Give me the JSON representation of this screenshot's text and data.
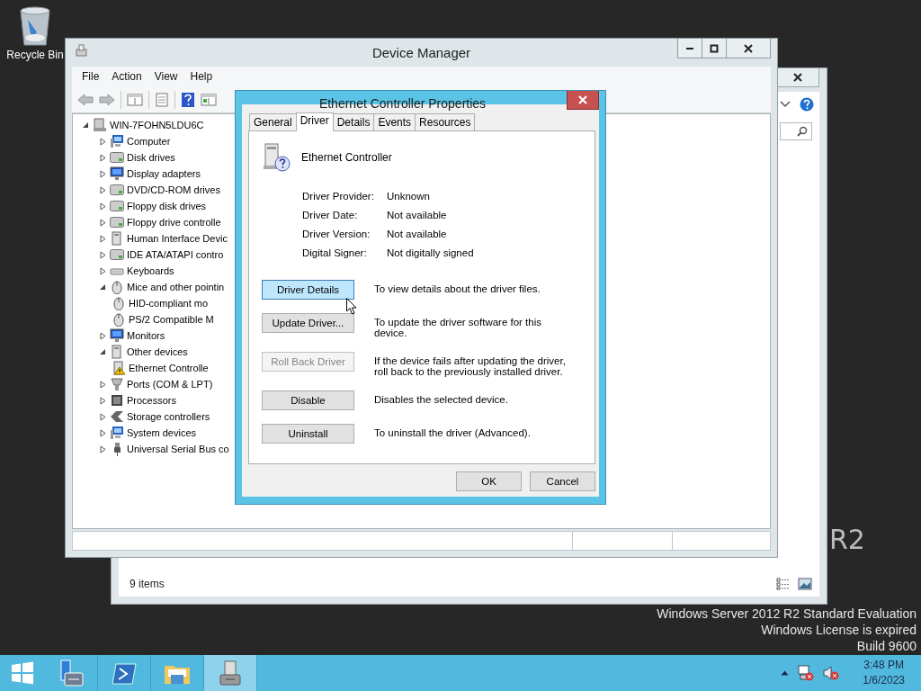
{
  "desktop": {
    "icons": [
      {
        "label": "Recycle Bin"
      }
    ],
    "brand": "R2",
    "notice": [
      "Windows Server 2012 R2 Standard Evaluation",
      "Windows License is expired",
      "Build 9600"
    ]
  },
  "back_window": {
    "status_bar": "9 items"
  },
  "device_manager": {
    "title": "Device Manager",
    "menu": [
      "File",
      "Action",
      "View",
      "Help"
    ],
    "tree": {
      "label": "WIN-7FOHN5LDU6C",
      "expanded": true,
      "children": [
        {
          "label": "Computer",
          "expanded": false
        },
        {
          "label": "Disk drives",
          "expanded": false
        },
        {
          "label": "Display adapters",
          "expanded": false
        },
        {
          "label": "DVD/CD-ROM drives",
          "expanded": false
        },
        {
          "label": "Floppy disk drives",
          "expanded": false
        },
        {
          "label": "Floppy drive controlle",
          "expanded": false
        },
        {
          "label": "Human Interface Devic",
          "expanded": false
        },
        {
          "label": "IDE ATA/ATAPI contro",
          "expanded": false
        },
        {
          "label": "Keyboards",
          "expanded": false
        },
        {
          "label": "Mice and other pointin",
          "expanded": true,
          "children": [
            {
              "label": "HID-compliant mo"
            },
            {
              "label": "PS/2 Compatible M"
            }
          ]
        },
        {
          "label": "Monitors",
          "expanded": false
        },
        {
          "label": "Other devices",
          "expanded": true,
          "children": [
            {
              "label": "Ethernet Controlle",
              "problem": true
            }
          ]
        },
        {
          "label": "Ports (COM & LPT)",
          "expanded": false
        },
        {
          "label": "Processors",
          "expanded": false
        },
        {
          "label": "Storage controllers",
          "expanded": false
        },
        {
          "label": "System devices",
          "expanded": false
        },
        {
          "label": "Universal Serial Bus co",
          "expanded": false
        }
      ]
    }
  },
  "properties_dialog": {
    "title": "Ethernet Controller Properties",
    "tabs": [
      {
        "label": "General",
        "selected": false
      },
      {
        "label": "Driver",
        "selected": true
      },
      {
        "label": "Details",
        "selected": false
      },
      {
        "label": "Events",
        "selected": false
      },
      {
        "label": "Resources",
        "selected": false
      }
    ],
    "device_name": "Ethernet Controller",
    "fields": [
      {
        "label": "Driver Provider:",
        "value": "Unknown"
      },
      {
        "label": "Driver Date:",
        "value": "Not available"
      },
      {
        "label": "Driver Version:",
        "value": "Not available"
      },
      {
        "label": "Digital Signer:",
        "value": "Not digitally signed"
      }
    ],
    "actions": [
      {
        "button": "Driver Details",
        "description": "To view details about the driver files.",
        "disabled": false,
        "hovered": true
      },
      {
        "button": "Update Driver...",
        "description": "To update the driver software for this device.",
        "disabled": false,
        "hovered": false
      },
      {
        "button": "Roll Back Driver",
        "description": "If the device fails after updating the driver, roll back to the previously installed driver.",
        "disabled": true,
        "hovered": false
      },
      {
        "button": "Disable",
        "description": "Disables the selected device.",
        "disabled": false,
        "hovered": false
      },
      {
        "button": "Uninstall",
        "description": "To uninstall the driver (Advanced).",
        "disabled": false,
        "hovered": false
      }
    ],
    "buttons": [
      "OK",
      "Cancel"
    ]
  },
  "taskbar": {
    "apps": [
      {
        "selected": false
      },
      {
        "selected": false
      },
      {
        "selected": false
      },
      {
        "selected": true
      }
    ],
    "clock": {
      "time": "3:48 PM",
      "date": "1/6/2023"
    }
  }
}
